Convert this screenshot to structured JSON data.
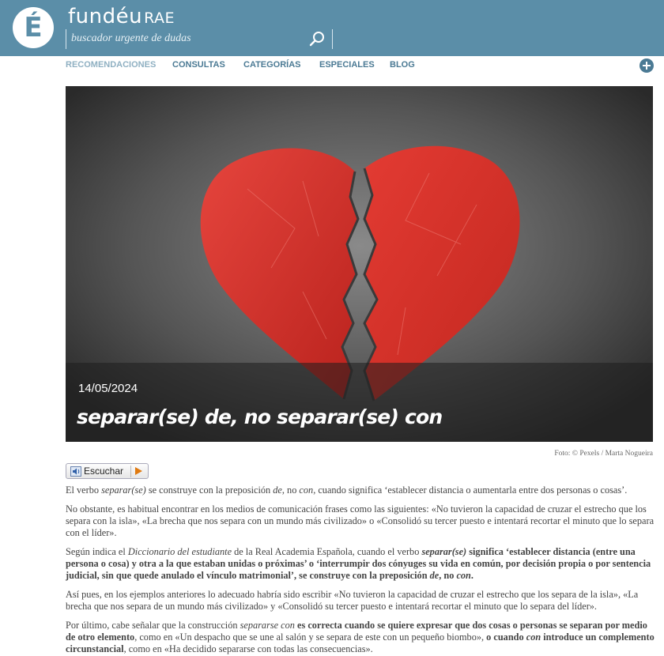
{
  "header": {
    "logo_glyph": "É",
    "brand_main": "fundéu",
    "brand_suffix": "RAE",
    "search_placeholder": "buscador urgente de dudas"
  },
  "nav": {
    "items": [
      "RECOMENDACIONES",
      "CONSULTAS",
      "CATEGORÍAS",
      "ESPECIALES",
      "BLOG"
    ],
    "active": "RECOMENDACIONES"
  },
  "hero": {
    "date": "14/05/2024",
    "title": "separar(se) de, no separar(se) con",
    "credit": "Foto: © Pexels / Marta Nogueira"
  },
  "listen_label": "Escuchar",
  "article": {
    "p1": [
      {
        "t": "El verbo ",
        "s": ""
      },
      {
        "t": "separar(se)",
        "s": "i"
      },
      {
        "t": " se construye con la preposición ",
        "s": ""
      },
      {
        "t": "de",
        "s": "i"
      },
      {
        "t": ", no ",
        "s": ""
      },
      {
        "t": "con",
        "s": "i"
      },
      {
        "t": ", cuando significa ‘establecer distancia o aumentarla entre dos personas o cosas’.",
        "s": ""
      }
    ],
    "p2": [
      {
        "t": "No obstante, es habitual encontrar en los medios de comunicación frases como las siguientes: «No tuvieron la capacidad de cruzar el estrecho que los separa con la isla», «La brecha que nos separa con un mundo más civilizado» o «Consolidó su tercer puesto e intentará recortar el minuto que lo separa con el líder».",
        "s": ""
      }
    ],
    "p3": [
      {
        "t": "Según indica el ",
        "s": ""
      },
      {
        "t": "Diccionario del estudiante",
        "s": "i"
      },
      {
        "t": " de la Real Academia Española, cuando el verbo ",
        "s": ""
      },
      {
        "t": "separar(se)",
        "s": "bi"
      },
      {
        "t": " significa ‘establecer distancia (entre una persona o cosa) y otra a la que estaban unidas o próximas’ o ‘interrumpir dos cónyuges su vida en común, por decisión propia o por sentencia judicial, sin que quede anulado el vínculo matrimonial’, se construye con la preposición ",
        "s": "b"
      },
      {
        "t": "de",
        "s": "bi"
      },
      {
        "t": ", no ",
        "s": "b"
      },
      {
        "t": "con",
        "s": "bi"
      },
      {
        "t": ".",
        "s": "b"
      }
    ],
    "p4": [
      {
        "t": "Así pues, en los ejemplos anteriores lo adecuado habría sido escribir «No tuvieron la capacidad de cruzar el estrecho que los separa de la isla», «La brecha que nos separa de un mundo más civilizado» y «Consolidó su tercer puesto e intentará recortar el minuto que lo separa del líder».",
        "s": ""
      }
    ],
    "p5": [
      {
        "t": "Por último, cabe señalar que la construcción ",
        "s": ""
      },
      {
        "t": "separarse con",
        "s": "i"
      },
      {
        "t": " es correcta cuando se quiere expresar que dos cosas o personas se separan por medio de otro elemento",
        "s": "b"
      },
      {
        "t": ", como en «Un despacho que se une al salón y se separa de este con un pequeño biombo», ",
        "s": ""
      },
      {
        "t": "o cuando ",
        "s": "b"
      },
      {
        "t": "con",
        "s": "bi"
      },
      {
        "t": " introduce un complemento circunstancial",
        "s": "b"
      },
      {
        "t": ", como en «Ha decidido separarse con todas las consecuencias».",
        "s": ""
      }
    ]
  },
  "colors": {
    "header_bg": "#5b8ea8",
    "nav_text": "#4b7a94",
    "nav_active": "#8fb0c2",
    "heart": "#d8332c",
    "listen_play": "#e07a10"
  },
  "icons": {
    "search": "magnifier-icon",
    "add": "plus-circle-icon",
    "speaker": "speaker-icon",
    "play": "play-icon"
  }
}
